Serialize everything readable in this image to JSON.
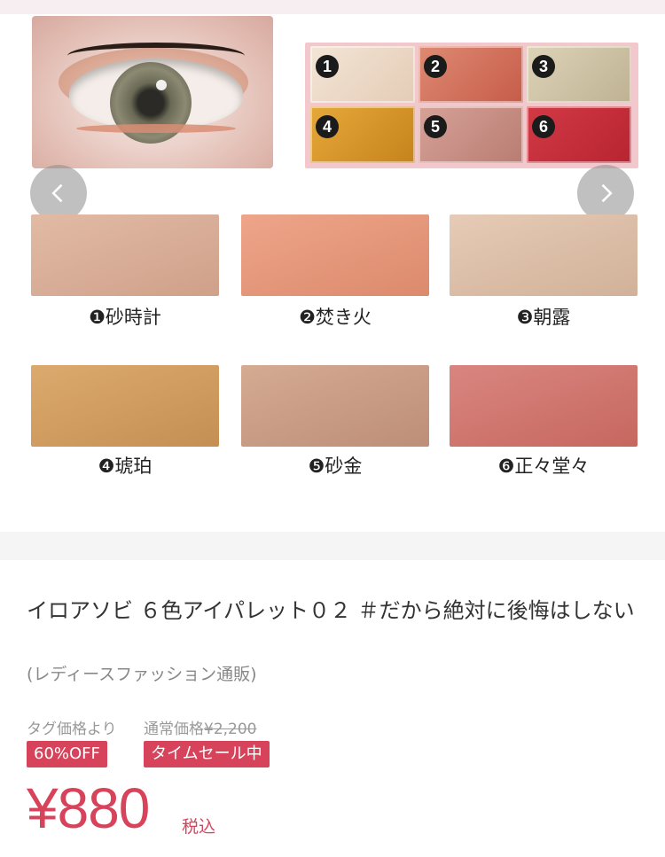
{
  "gallery": {
    "palette_numbers": [
      "1",
      "2",
      "3",
      "4",
      "5",
      "6"
    ],
    "palette_colors": [
      "#eedbc9",
      "#d7735f",
      "#cfc3a6",
      "#d9962a",
      "#c98f86",
      "#c7303b"
    ],
    "swatches": [
      {
        "label": "❶砂時計",
        "color": "#d9b09a"
      },
      {
        "label": "❷焚き火",
        "color": "#e59a7c"
      },
      {
        "label": "❸朝露",
        "color": "#dcbfa8"
      },
      {
        "label": "❹琥珀",
        "color": "#d19f63"
      },
      {
        "label": "❺砂金",
        "color": "#c9a088"
      },
      {
        "label": "❻正々堂々",
        "color": "#cf756f"
      }
    ],
    "prev_icon": "chevron-left-icon",
    "next_icon": "chevron-right-icon"
  },
  "product": {
    "title": "イロアソビ ６色アイパレット０２ ＃だから絶対に後悔はしない",
    "subtitle": "(レディースファッション通販)"
  },
  "pricing": {
    "tag_price_label": "タグ価格より",
    "regular_price_label": "通常価格",
    "regular_price": "¥2,200",
    "discount_badge": "60%OFF",
    "sale_badge": "タイムセール中",
    "price": "¥880",
    "tax_label": "税込",
    "accent_color": "#d6435b"
  }
}
